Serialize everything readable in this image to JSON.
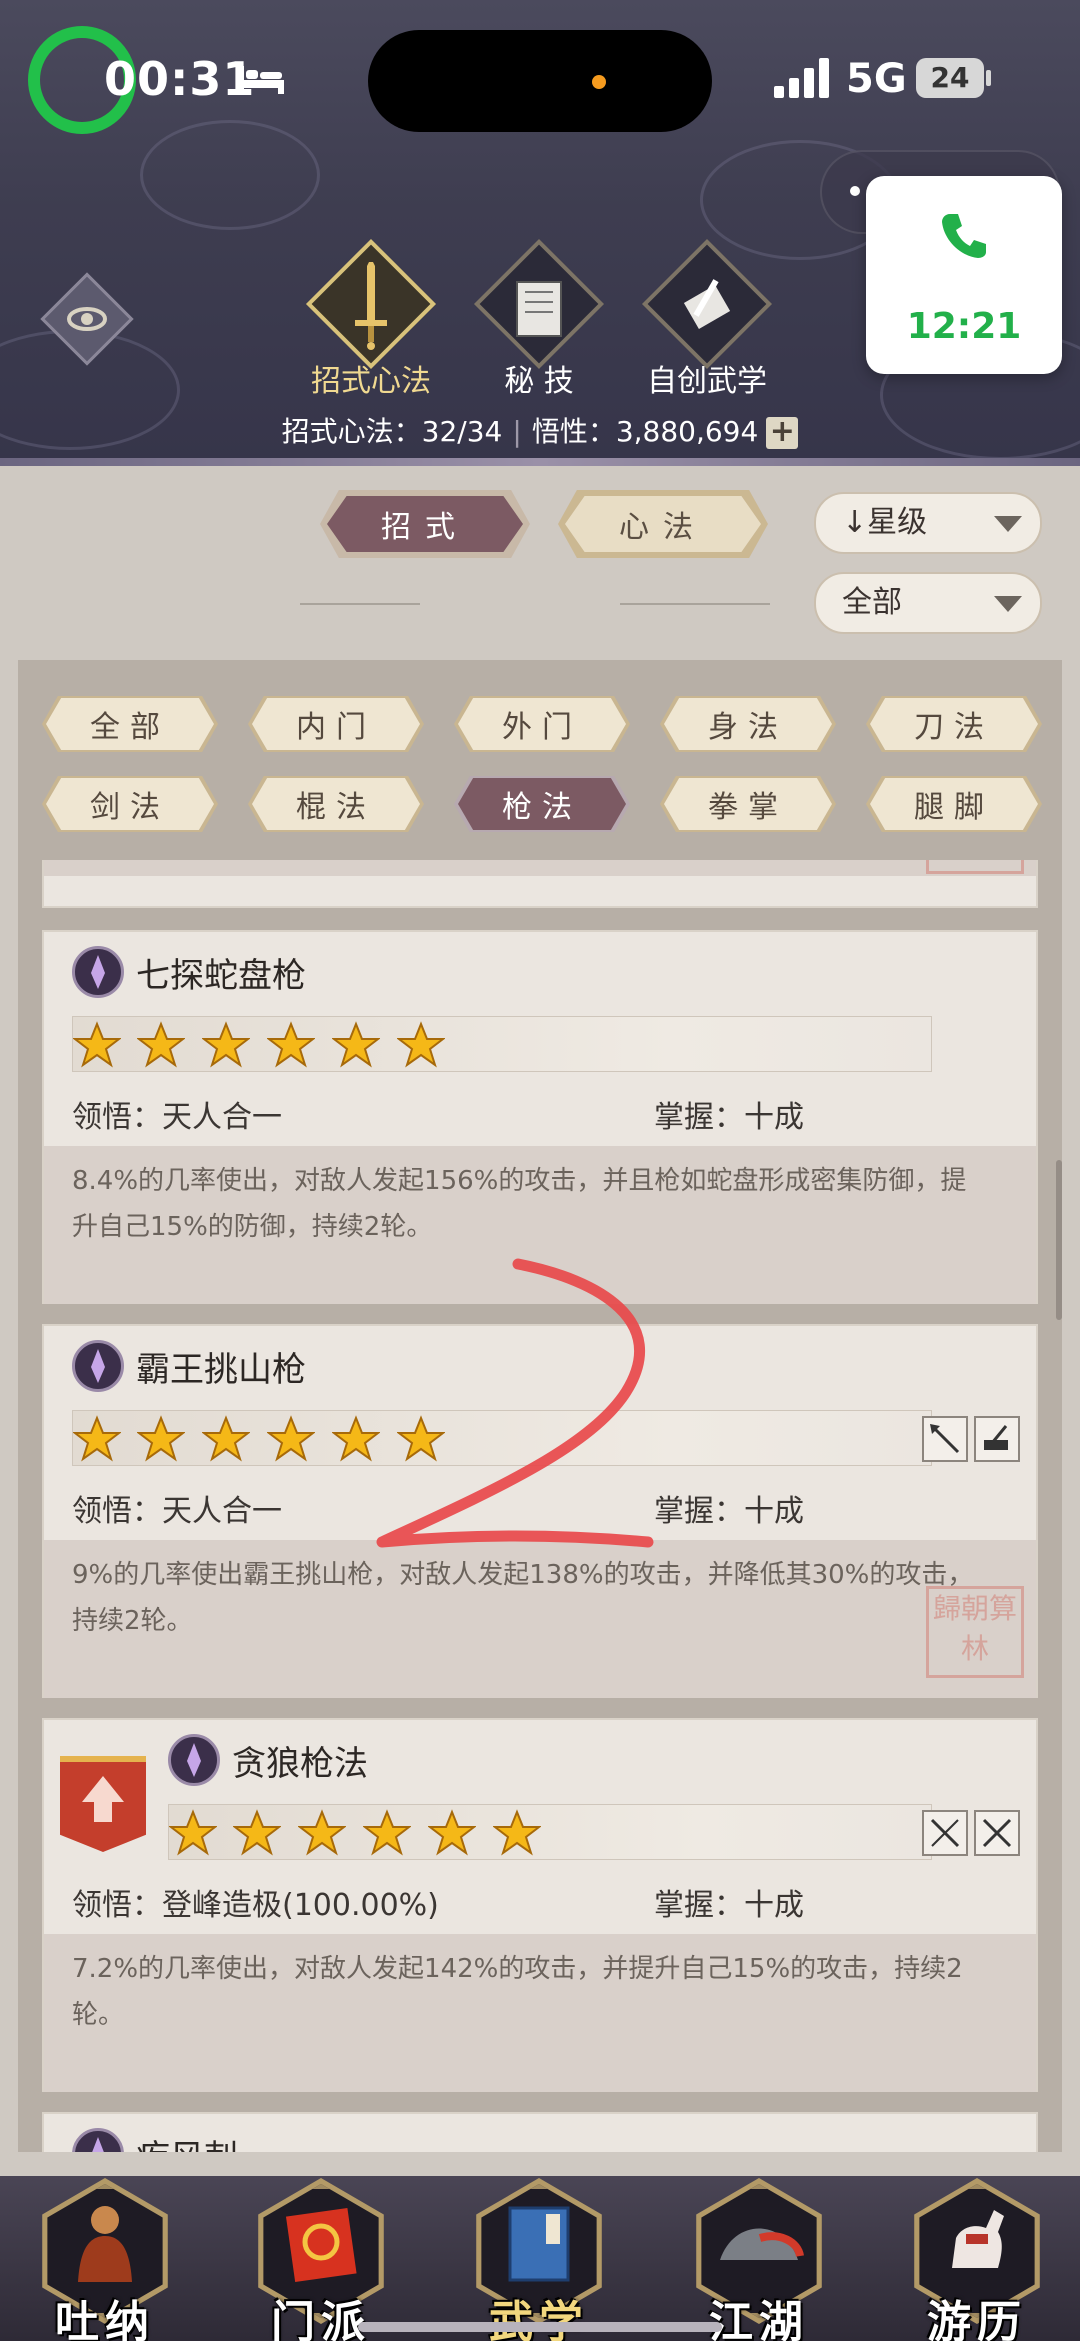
{
  "status_bar": {
    "time": "00:31",
    "network": "5G",
    "battery": "24"
  },
  "call_widget": {
    "time": "12:21"
  },
  "header": {
    "tabs": [
      {
        "label": "招式心法",
        "active": true
      },
      {
        "label": "秘 技",
        "active": false
      },
      {
        "label": "自创武学",
        "active": false
      }
    ],
    "stats": {
      "moves_label": "招式心法：32/34",
      "insight_label": "悟性：3,880,694"
    }
  },
  "mode_tabs": [
    {
      "label": "招式",
      "active": true
    },
    {
      "label": "心法",
      "active": false
    }
  ],
  "sort_dropdown": {
    "value": "星级"
  },
  "filter_dropdown": {
    "value": "全部"
  },
  "categories": [
    {
      "label": "全部",
      "active": false
    },
    {
      "label": "内门",
      "active": false
    },
    {
      "label": "外门",
      "active": false
    },
    {
      "label": "身法",
      "active": false
    },
    {
      "label": "刀法",
      "active": false
    },
    {
      "label": "剑法",
      "active": false
    },
    {
      "label": "棍法",
      "active": false
    },
    {
      "label": "枪法",
      "active": true
    },
    {
      "label": "拳掌",
      "active": false
    },
    {
      "label": "腿脚",
      "active": false
    }
  ],
  "skills": [
    {
      "name": "七探蛇盘枪",
      "stars": 6,
      "comprehension": "领悟：天人合一",
      "mastery": "掌握：十成",
      "description": "8.4%的几率使出，对敌人发起156%的攻击，并且枪如蛇盘形成密集防御，提升自己15%的防御，持续2轮。"
    },
    {
      "name": "霸王挑山枪",
      "stars": 6,
      "comprehension": "领悟：天人合一",
      "mastery": "掌握：十成",
      "description": "9%的几率使出霸王挑山枪，对敌人发起138%的攻击，并降低其30%的攻击，持续2轮。"
    },
    {
      "name": "贪狼枪法",
      "stars": 6,
      "comprehension": "领悟：登峰造极(100.00%)",
      "mastery": "掌握：十成",
      "description": "7.2%的几率使出，对敌人发起142%的攻击，并提升自己15%的攻击，持续2轮。"
    },
    {
      "name": "疾风刺"
    }
  ],
  "seal_text": "歸朝算 林",
  "bottom_nav": [
    {
      "label": "吐纳",
      "active": false
    },
    {
      "label": "门派",
      "active": false
    },
    {
      "label": "武学",
      "active": true
    },
    {
      "label": "江湖",
      "active": false
    },
    {
      "label": "游历",
      "active": false
    }
  ],
  "colors": {
    "accent_active": "#7c5a63",
    "header_bg": "#3e3d50",
    "star_gold": "#f5b817",
    "annotation_red": "#e8494b",
    "call_green": "#22b04a"
  }
}
